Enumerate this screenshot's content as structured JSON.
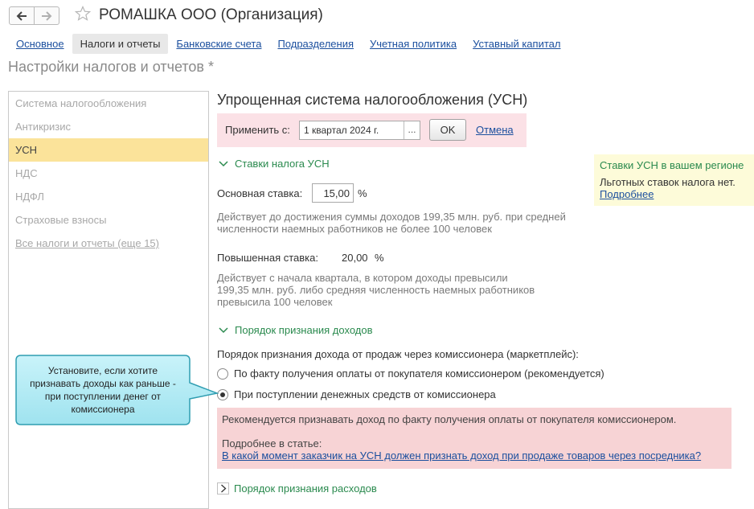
{
  "window": {
    "title": "РОМАШКА ООО (Организация)"
  },
  "icons": {
    "back": "arrow-left-icon",
    "forward": "arrow-right-icon",
    "favorite": "star-icon",
    "chevron": "chevron-down-icon",
    "expand": "chevron-right-icon"
  },
  "tabs": [
    {
      "label": "Основное"
    },
    {
      "label": "Налоги и отчеты",
      "active": true
    },
    {
      "label": "Банковские счета"
    },
    {
      "label": "Подразделения"
    },
    {
      "label": "Учетная политика"
    },
    {
      "label": "Уставный капитал"
    }
  ],
  "section_title": "Настройки налогов и отчетов *",
  "sidebar": {
    "items": [
      {
        "label": "Система налогообложения"
      },
      {
        "label": "Антикризис"
      },
      {
        "label": "УСН",
        "selected": true
      },
      {
        "label": "НДС"
      },
      {
        "label": "НДФЛ"
      },
      {
        "label": "Страховые взносы"
      },
      {
        "label": "Все налоги и отчеты (еще 15)",
        "link": true
      }
    ]
  },
  "main": {
    "heading": "Упрощенная система налогообложения (УСН)",
    "apply": {
      "label": "Применить с:",
      "value": "1 квартал 2024 г.",
      "select_btn": "...",
      "ok": "OK",
      "cancel": "Отмена"
    },
    "rates_group": {
      "title": "Ставки налога УСН",
      "base_label": "Основная ставка:",
      "base_value": "15,00",
      "base_unit": "%",
      "base_note": [
        "Действует до достижения суммы доходов 199,35 млн. руб. при средней",
        "численности наемных работников не более 100 человек"
      ],
      "raised_label": "Повышенная ставка:",
      "raised_value": "20,00",
      "raised_unit": "%",
      "raised_note": [
        "Действует с начала квартала, в котором доходы превысили",
        "199,35 млн. руб. либо средняя численность наемных работников",
        "превысила 100 человек"
      ]
    },
    "income_group": {
      "title": "Порядок признания доходов",
      "question": "Порядок признания дохода от продаж через комиссионера (маркетплейс):",
      "options": [
        {
          "label": "По факту получения оплаты от покупателя комиссионером (рекомендуется)",
          "checked": false
        },
        {
          "label": "При поступлении денежных средств от комиссионера",
          "checked": true
        }
      ]
    },
    "warning": {
      "text": "Рекомендуется признавать доход по факту получения оплаты от покупателя комиссионером.",
      "more": "Подробнее в статье:",
      "link": "В какой момент заказчик на УСН должен признать доход при продаже товаров через посредника?"
    },
    "expenses_group": {
      "title": "Порядок признания расходов"
    }
  },
  "region_box": {
    "title": "Ставки УСН в вашем регионе",
    "text": "Льготных ставок налога нет.",
    "link": "Подробнее"
  },
  "callout": {
    "lines": [
      "Установите, если хотите",
      "признавать доходы как раньше -",
      "при поступлении денег от",
      "комиссионера"
    ]
  },
  "colors": {
    "accent_green": "#2a8a4e",
    "link_blue": "#1b4f9e",
    "selected_yellow": "#fbe39a",
    "pink_bg": "#fbe1e6",
    "warning_pink": "#f7d3d5",
    "callout_cyan": "#bfeff7"
  }
}
